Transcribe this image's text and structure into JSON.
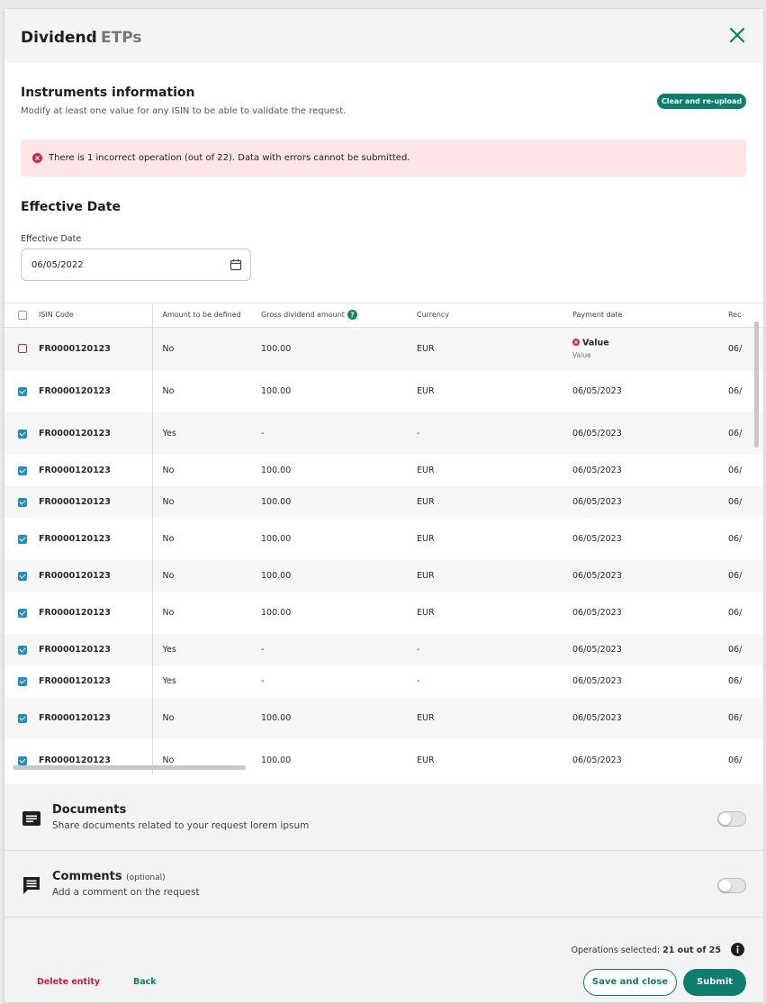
{
  "header": {
    "tabs": [
      {
        "label": "Dividend",
        "active": true
      },
      {
        "label": "ETPs",
        "active": false
      }
    ]
  },
  "instruments": {
    "title": "Instruments information",
    "subtitle": "Modify at least one value for any ISIN to be able to validate the request.",
    "reupload_label": "Clear and re-upload",
    "error_message": "There is 1 incorrect operation (out of 22). Data with errors cannot be submitted."
  },
  "effective_date": {
    "section_title": "Effective Date",
    "field_label": "Effective Date",
    "value": "06/05/2022"
  },
  "table": {
    "columns": [
      "ISIN Code",
      "Amount to be defined",
      "Gross dividend amount",
      "Currency",
      "Payment date",
      "Rec"
    ],
    "rows": [
      {
        "state": "error",
        "isin": "FR0000120123",
        "amount_defined": "No",
        "gross": "100.00",
        "currency": "EUR",
        "payment": "Value",
        "payment_sub": "Value",
        "rec": "06/"
      },
      {
        "state": "checked",
        "isin": "FR0000120123",
        "amount_defined": "No",
        "gross": "100.00",
        "currency": "EUR",
        "payment": "06/05/2023",
        "rec": "06/"
      },
      {
        "state": "checked",
        "isin": "FR0000120123",
        "amount_defined": "Yes",
        "gross": "-",
        "currency": "-",
        "payment": "06/05/2023",
        "rec": "06/"
      },
      {
        "state": "checked",
        "isin": "FR0000120123",
        "amount_defined": "No",
        "gross": "100.00",
        "currency": "EUR",
        "payment": "06/05/2023",
        "rec": "06/"
      },
      {
        "state": "checked",
        "isin": "FR0000120123",
        "amount_defined": "No",
        "gross": "100.00",
        "currency": "EUR",
        "payment": "06/05/2023",
        "rec": "06/"
      },
      {
        "state": "checked",
        "isin": "FR0000120123",
        "amount_defined": "No",
        "gross": "100.00",
        "currency": "EUR",
        "payment": "06/05/2023",
        "rec": "06/"
      },
      {
        "state": "checked",
        "isin": "FR0000120123",
        "amount_defined": "No",
        "gross": "100.00",
        "currency": "EUR",
        "payment": "06/05/2023",
        "rec": "06/"
      },
      {
        "state": "checked",
        "isin": "FR0000120123",
        "amount_defined": "No",
        "gross": "100.00",
        "currency": "EUR",
        "payment": "06/05/2023",
        "rec": "06/"
      },
      {
        "state": "checked",
        "isin": "FR0000120123",
        "amount_defined": "Yes",
        "gross": "-",
        "currency": "-",
        "payment": "06/05/2023",
        "rec": "06/"
      },
      {
        "state": "checked",
        "isin": "FR0000120123",
        "amount_defined": "Yes",
        "gross": "-",
        "currency": "-",
        "payment": "06/05/2023",
        "rec": "06/"
      },
      {
        "state": "checked",
        "isin": "FR0000120123",
        "amount_defined": "No",
        "gross": "100.00",
        "currency": "EUR",
        "payment": "06/05/2023",
        "rec": "06/"
      },
      {
        "state": "checked",
        "isin": "FR0000120123",
        "amount_defined": "No",
        "gross": "100.00",
        "currency": "EUR",
        "payment": "06/05/2023",
        "rec": "06/"
      }
    ]
  },
  "documents": {
    "title": "Documents",
    "subtitle": "Share documents related to your request lorem ipsum",
    "enabled": false
  },
  "comments": {
    "title": "Comments",
    "optional_label": "(optional)",
    "subtitle": "Add a comment on the request",
    "enabled": false
  },
  "footer": {
    "ops_label": "Operations selected:",
    "ops_value": "21 out of 25",
    "delete_label": "Delete entity",
    "back_label": "Back",
    "save_label": "Save and close",
    "submit_label": "Submit"
  },
  "colors": {
    "accent": "#0d7d6c",
    "error": "#d7263d",
    "error_bg": "#fde4e6",
    "checkbox": "#1f8fc9"
  }
}
